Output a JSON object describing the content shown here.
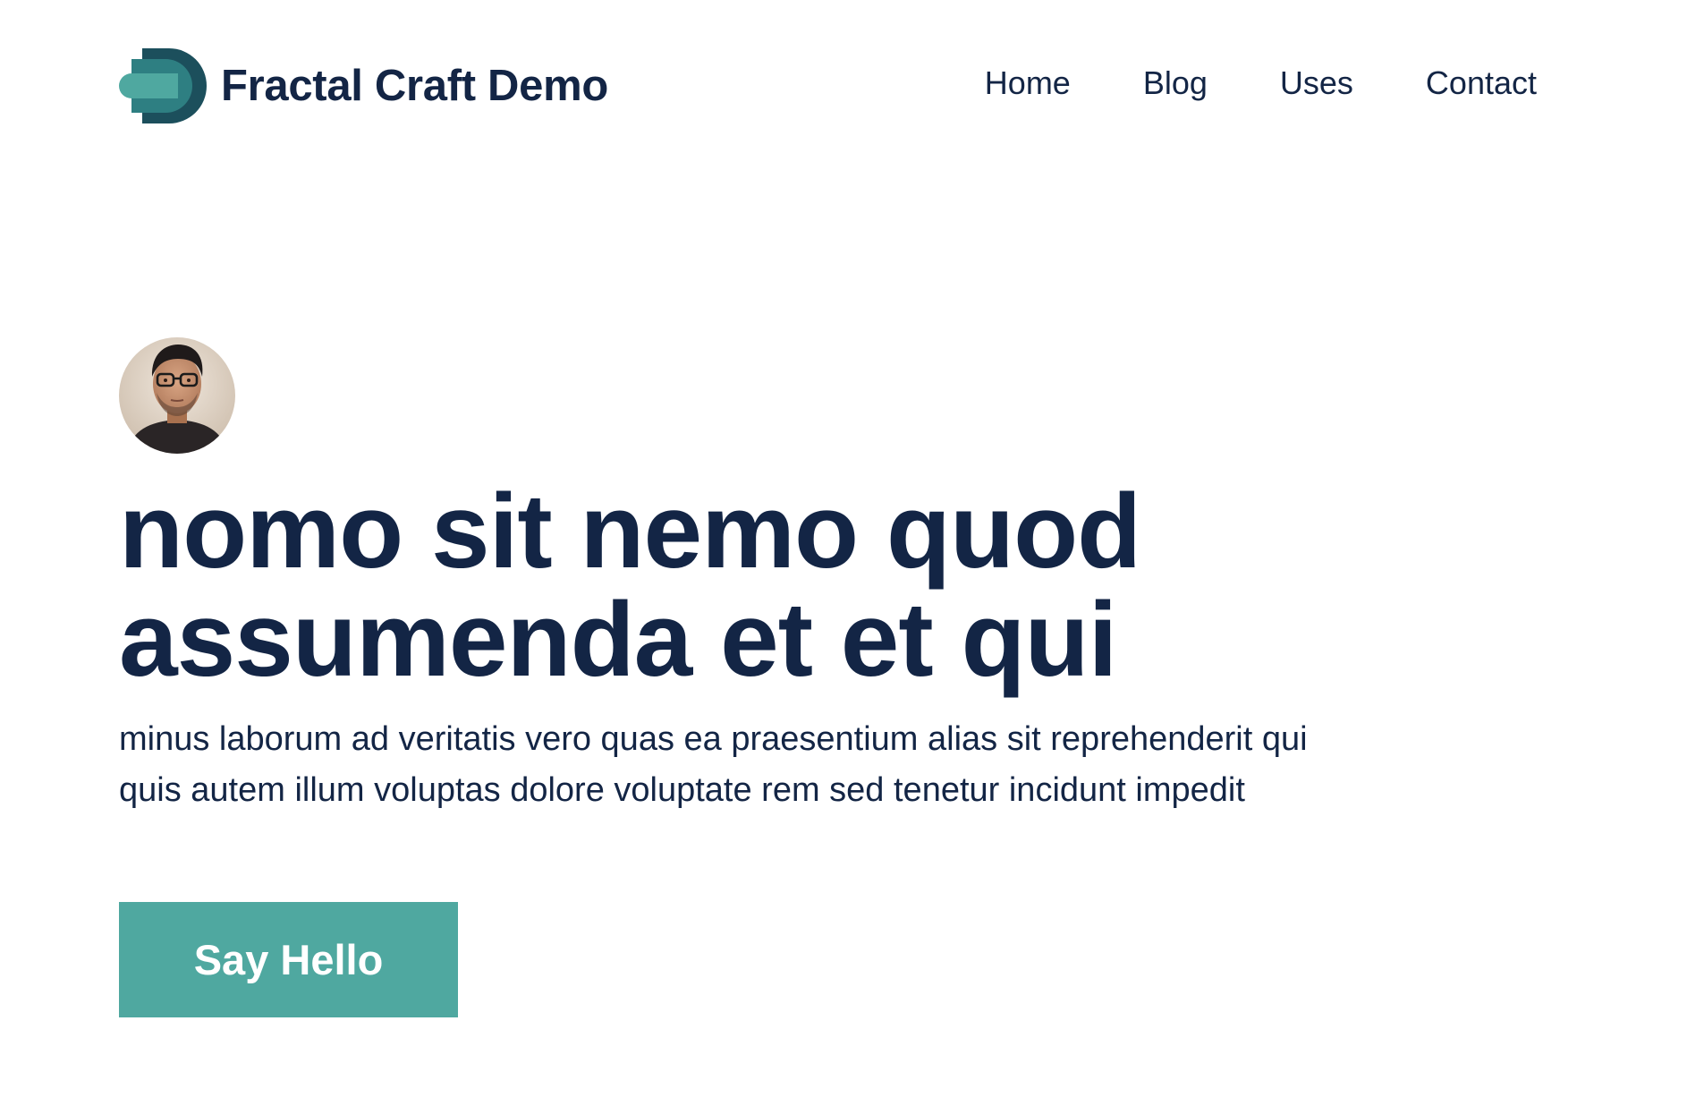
{
  "header": {
    "brand_name": "Fractal Craft Demo",
    "logo_icon": "fractal-d-logo-icon",
    "nav": [
      {
        "label": "Home"
      },
      {
        "label": "Blog"
      },
      {
        "label": "Uses"
      },
      {
        "label": "Contact"
      }
    ]
  },
  "hero": {
    "avatar": "profile-photo",
    "headline_line1": "nomo sit nemo quod",
    "headline_line2": "assumenda et et qui",
    "description_line1": "minus laborum ad veritatis vero quas ea praesentium alias sit reprehenderit qui",
    "description_line2": "quis autem illum voluptas dolore voluptate rem sed tenetur incidunt impedit",
    "cta_label": "Say Hello"
  },
  "colors": {
    "text": "#132545",
    "accent": "#4fa8a0",
    "logo_dark": "#1c4f5c",
    "background": "#ffffff"
  }
}
